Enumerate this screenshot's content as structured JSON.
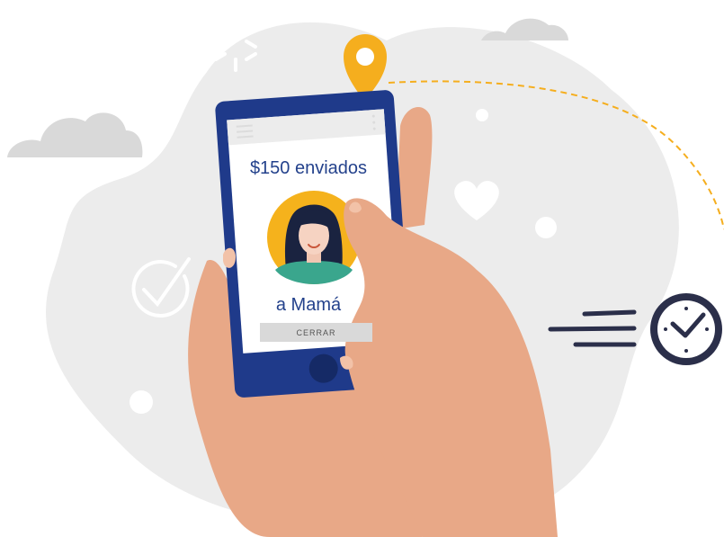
{
  "notification": {
    "amount_text": "$150 enviados",
    "recipient_text": "a Mamá",
    "close_label": "CERRAR"
  },
  "icons": {
    "location": "map-pin-icon",
    "heart": "heart-icon",
    "check": "check-circle-icon",
    "clock": "clock-icon",
    "menu": "hamburger-menu-icon",
    "more": "kebab-menu-icon",
    "avatar": "woman-avatar-icon"
  },
  "colors": {
    "blob": "#ececec",
    "phone": "#1f3a8a",
    "text": "#24428c",
    "pin": "#f5ae1e",
    "avatar_bg": "#f5b21c",
    "skin": "#e8a887",
    "clock": "#2b2f4a"
  }
}
